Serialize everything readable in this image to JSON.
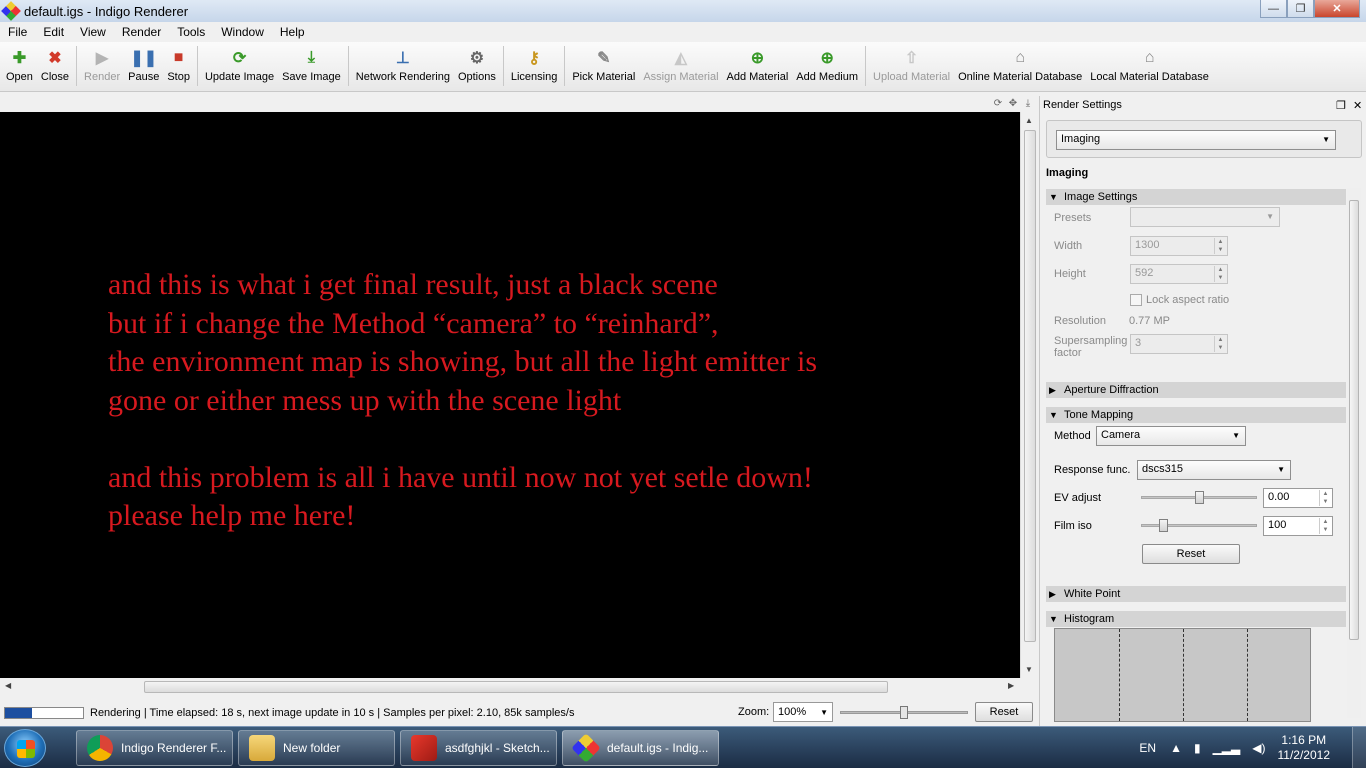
{
  "window": {
    "title": "default.igs - Indigo Renderer",
    "minimize": "—",
    "maximize": "❐",
    "close": "✕"
  },
  "menu": [
    "File",
    "Edit",
    "View",
    "Render",
    "Tools",
    "Window",
    "Help"
  ],
  "toolbar": {
    "open": "Open",
    "close": "Close",
    "render": "Render",
    "pause": "Pause",
    "stop": "Stop",
    "update_image": "Update Image",
    "save_image": "Save Image",
    "network_rendering": "Network Rendering",
    "options": "Options",
    "licensing": "Licensing",
    "pick_material": "Pick Material",
    "assign_material": "Assign Material",
    "add_material": "Add Material",
    "add_medium": "Add Medium",
    "upload_material": "Upload Material",
    "online_material_database": "Online Material Database",
    "local_material_database": "Local Material Database"
  },
  "overlay_text": {
    "line1": "and this is what i get final result, just a black scene",
    "line2": "but if i change the Method  “camera” to “reinhard”,",
    "line3": "the environment map is showing, but all the light emitter is",
    "line4": "gone or either mess up with the scene light",
    "line5": "and this problem is all i have until now not yet setle down!",
    "line6": "please help me here!"
  },
  "status": {
    "progress": 0.34,
    "text": "Rendering | Time elapsed: 18 s, next image update in 10 s | Samples per pixel: 2.10, 85k samples/s",
    "zoom_label": "Zoom:",
    "zoom_value": "100%",
    "zoom_slider": 0.5,
    "reset": "Reset"
  },
  "render_settings": {
    "title": "Render Settings",
    "mode": "Imaging",
    "heading": "Imaging",
    "image_settings": {
      "title": "Image Settings",
      "presets_label": "Presets",
      "presets_value": "",
      "width_label": "Width",
      "width_value": "1300",
      "height_label": "Height",
      "height_value": "592",
      "lock_aspect": "Lock aspect ratio",
      "resolution_label": "Resolution",
      "resolution_value": "0.77 MP",
      "supersampling_label1": "Supersampling",
      "supersampling_label2": "factor",
      "supersampling_value": "3"
    },
    "aperture_diffraction": "Aperture Diffraction",
    "tone_mapping": {
      "title": "Tone Mapping",
      "method_label": "Method",
      "method_value": "Camera",
      "response_label": "Response func.",
      "response_value": "dscs315",
      "ev_label": "EV adjust",
      "ev_value": "0.00",
      "ev_slider": 0.5,
      "iso_label": "Film iso",
      "iso_value": "100",
      "iso_slider": 0.16,
      "reset": "Reset"
    },
    "white_point": "White Point",
    "histogram": "Histogram"
  },
  "taskbar": {
    "tasks": [
      {
        "label": "Indigo Renderer F...",
        "icon": "chrome-icon"
      },
      {
        "label": "New folder",
        "icon": "folder-icon"
      },
      {
        "label": "asdfghjkl - Sketch...",
        "icon": "sketchup-icon"
      },
      {
        "label": "default.igs - Indig...",
        "icon": "indigo-icon"
      }
    ],
    "language": "EN",
    "time": "1:16 PM",
    "date": "11/2/2012"
  }
}
